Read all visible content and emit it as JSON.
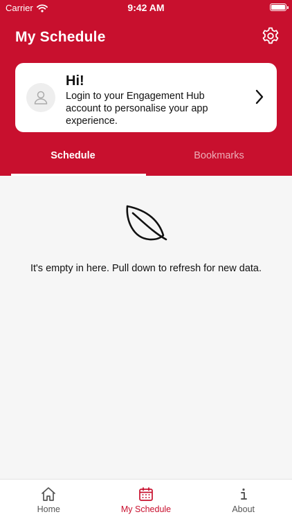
{
  "status_bar": {
    "carrier": "Carrier",
    "time": "9:42 AM"
  },
  "header": {
    "title": "My Schedule",
    "settings_icon": "gear-icon"
  },
  "login_card": {
    "greeting": "Hi!",
    "message": "Login to your Engagement Hub account to personalise your app experience.",
    "avatar_icon": "user-icon",
    "chevron_icon": "chevron-right-icon"
  },
  "tabs": [
    {
      "label": "Schedule",
      "active": true
    },
    {
      "label": "Bookmarks",
      "active": false
    }
  ],
  "empty_state": {
    "icon": "leaf-icon",
    "text": "It's empty in here. Pull down to refresh for new data."
  },
  "tab_bar": {
    "items": [
      {
        "label": "Home",
        "icon": "home-icon"
      },
      {
        "label": "My Schedule",
        "icon": "calendar-icon",
        "active": true
      },
      {
        "label": "About",
        "icon": "info-icon"
      }
    ]
  },
  "colors": {
    "accent": "#c8102e",
    "background": "#f6f6f6",
    "card": "#ffffff"
  }
}
